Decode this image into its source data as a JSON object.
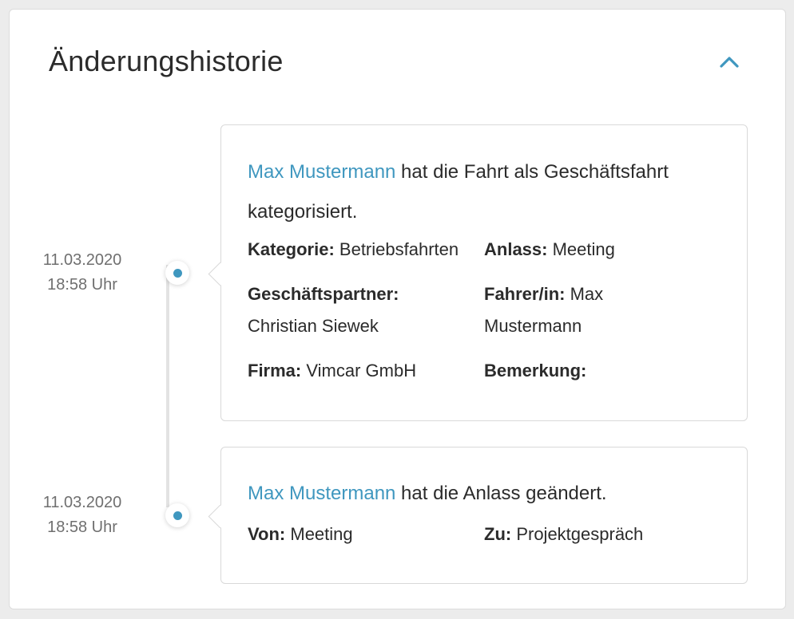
{
  "panel": {
    "title": "Änderungshistorie",
    "collapse_icon": "chevron-up-icon",
    "accent_color": "#3f97bf"
  },
  "entries": [
    {
      "date": "11.03.2020",
      "time": "18:58 Uhr",
      "user": "Max Mustermann",
      "action": " hat die Fahrt als Geschäftsfahrt kategorisiert.",
      "fields": [
        {
          "label": "Kategorie:",
          "value": " Betriebsfahrten"
        },
        {
          "label": "Anlass:",
          "value": " Meeting"
        },
        {
          "label": "Geschäftspartner:",
          "value": "Christian Siewek"
        },
        {
          "label": "Fahrer/in:",
          "value": " Max Mustermann"
        },
        {
          "label": "Firma:",
          "value": " Vimcar GmbH"
        },
        {
          "label": "Bemerkung:",
          "value": ""
        }
      ]
    },
    {
      "date": "11.03.2020",
      "time": "18:58 Uhr",
      "user": "Max Mustermann",
      "action": " hat die Anlass geändert.",
      "fields": [
        {
          "label": "Von:",
          "value": " Meeting"
        },
        {
          "label": "Zu:",
          "value": " Projektgespräch"
        }
      ]
    }
  ]
}
